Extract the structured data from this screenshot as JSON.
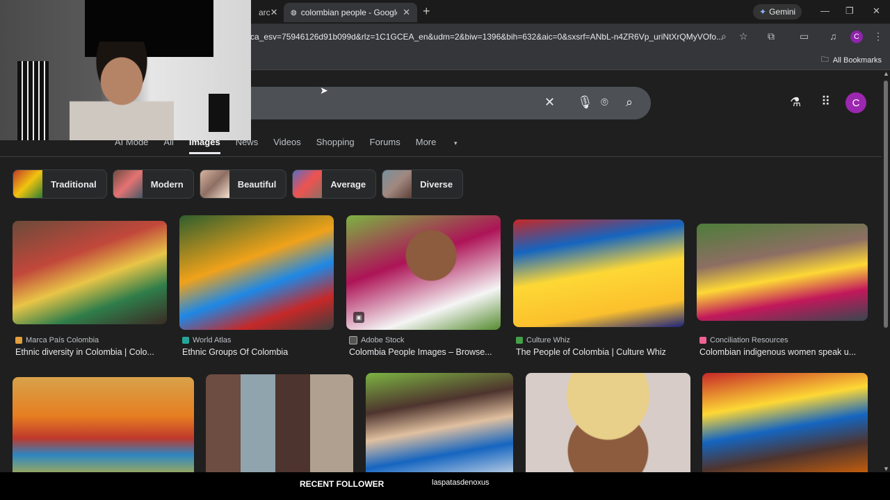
{
  "tabs": [
    {
      "label": "arc"
    },
    {
      "label": "colombian people - Google Se"
    }
  ],
  "gemini_label": "Gemini",
  "url": "ca_esv=75946126d91b099d&rlz=1C1GCEA_en&udm=2&biw=1396&bih=632&aic=0&sxsrf=ANbL-n4ZR6Vp_uriNtXrQMyVOfo...",
  "profile_initial": "C",
  "all_bookmarks": "All Bookmarks",
  "nav_tabs": [
    "AI Mode",
    "All",
    "Images",
    "News",
    "Videos",
    "Shopping",
    "Forums",
    "More"
  ],
  "active_tab": "Images",
  "chips": [
    "Traditional",
    "Modern",
    "Beautiful",
    "Average",
    "Diverse"
  ],
  "results_row1": [
    {
      "source": "Marca País Colombia",
      "title": "Ethnic diversity in Colombia | Colo..."
    },
    {
      "source": "World Atlas",
      "title": "Ethnic Groups Of Colombia"
    },
    {
      "source": "Adobe Stock",
      "title": "Colombia People Images – Browse..."
    },
    {
      "source": "Culture Whiz",
      "title": "The People of Colombia | Culture Whiz"
    },
    {
      "source": "Conciliation Resources",
      "title": "Colombian indigenous women speak u..."
    }
  ],
  "overlay": {
    "recent_follower_label": "RECENT FOLLOWER",
    "recent_follower_name": "laspatasdenoxus"
  },
  "colors": {
    "accent": "#9c27b0",
    "background": "#1f1f1f",
    "searchbox": "#4d5156"
  }
}
